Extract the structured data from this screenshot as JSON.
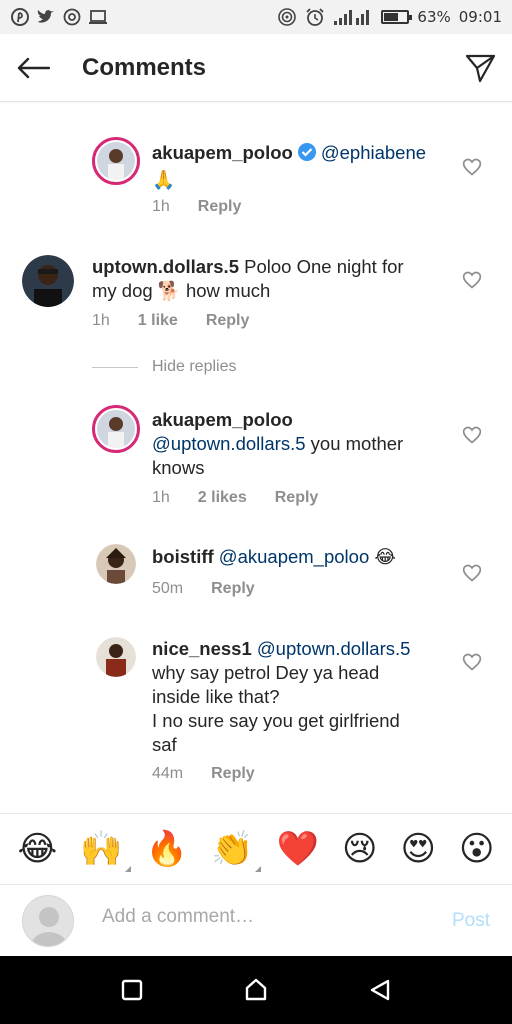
{
  "status_bar": {
    "battery_text": "63%",
    "battery_level": 0.63,
    "time": "09:01"
  },
  "header": {
    "title": "Comments"
  },
  "comments": [
    {
      "username": "akuapem_poloo",
      "verified": true,
      "mention": "@ephiabene",
      "text_line2": "🙏",
      "time": "1h",
      "reply": "Reply"
    },
    {
      "username": "uptown.dollars.5",
      "text": "Poloo One night for my dog 🐕 how much",
      "text_a": "Poloo One night for",
      "text_b": "my dog 🐕 how much",
      "time": "1h",
      "likes": "1 like",
      "reply": "Reply"
    },
    {
      "username": "akuapem_poloo",
      "mention": "@uptown.dollars.5",
      "text_a": " you mother",
      "text_b": "knows",
      "time": "1h",
      "likes": "2 likes",
      "reply": "Reply"
    },
    {
      "username": "boistiff",
      "mention": "@akuapem_poloo",
      "emoji": "😂",
      "time": "50m",
      "reply": "Reply"
    },
    {
      "username": "nice_ness1",
      "mention": "@uptown.dollars.5",
      "line1": "why say petrol Dey ya head",
      "line2": "inside like that?",
      "line3": "I no sure say you get girlfriend",
      "line4": "saf",
      "time": "44m",
      "reply": "Reply"
    }
  ],
  "hide_replies": "Hide replies",
  "emoji_bar": [
    "😂",
    "🙌",
    "🔥",
    "👏",
    "❤️",
    "😢",
    "😍",
    "😮"
  ],
  "composer": {
    "placeholder": "Add a comment…",
    "post_label": "Post"
  },
  "colors": {
    "text": "#262626",
    "meta": "#8e8e8e",
    "mention": "#003569",
    "verified": "#3897f0",
    "post_disabled": "#b2dffc",
    "story_ring": "#d62976",
    "nav_bar": "#000000"
  },
  "icons": {
    "back": "arrow-left-icon",
    "send": "paper-plane-icon",
    "heart": "heart-outline-icon",
    "nav_recent": "square-icon",
    "nav_home": "home-icon",
    "nav_back": "triangle-back-icon"
  }
}
